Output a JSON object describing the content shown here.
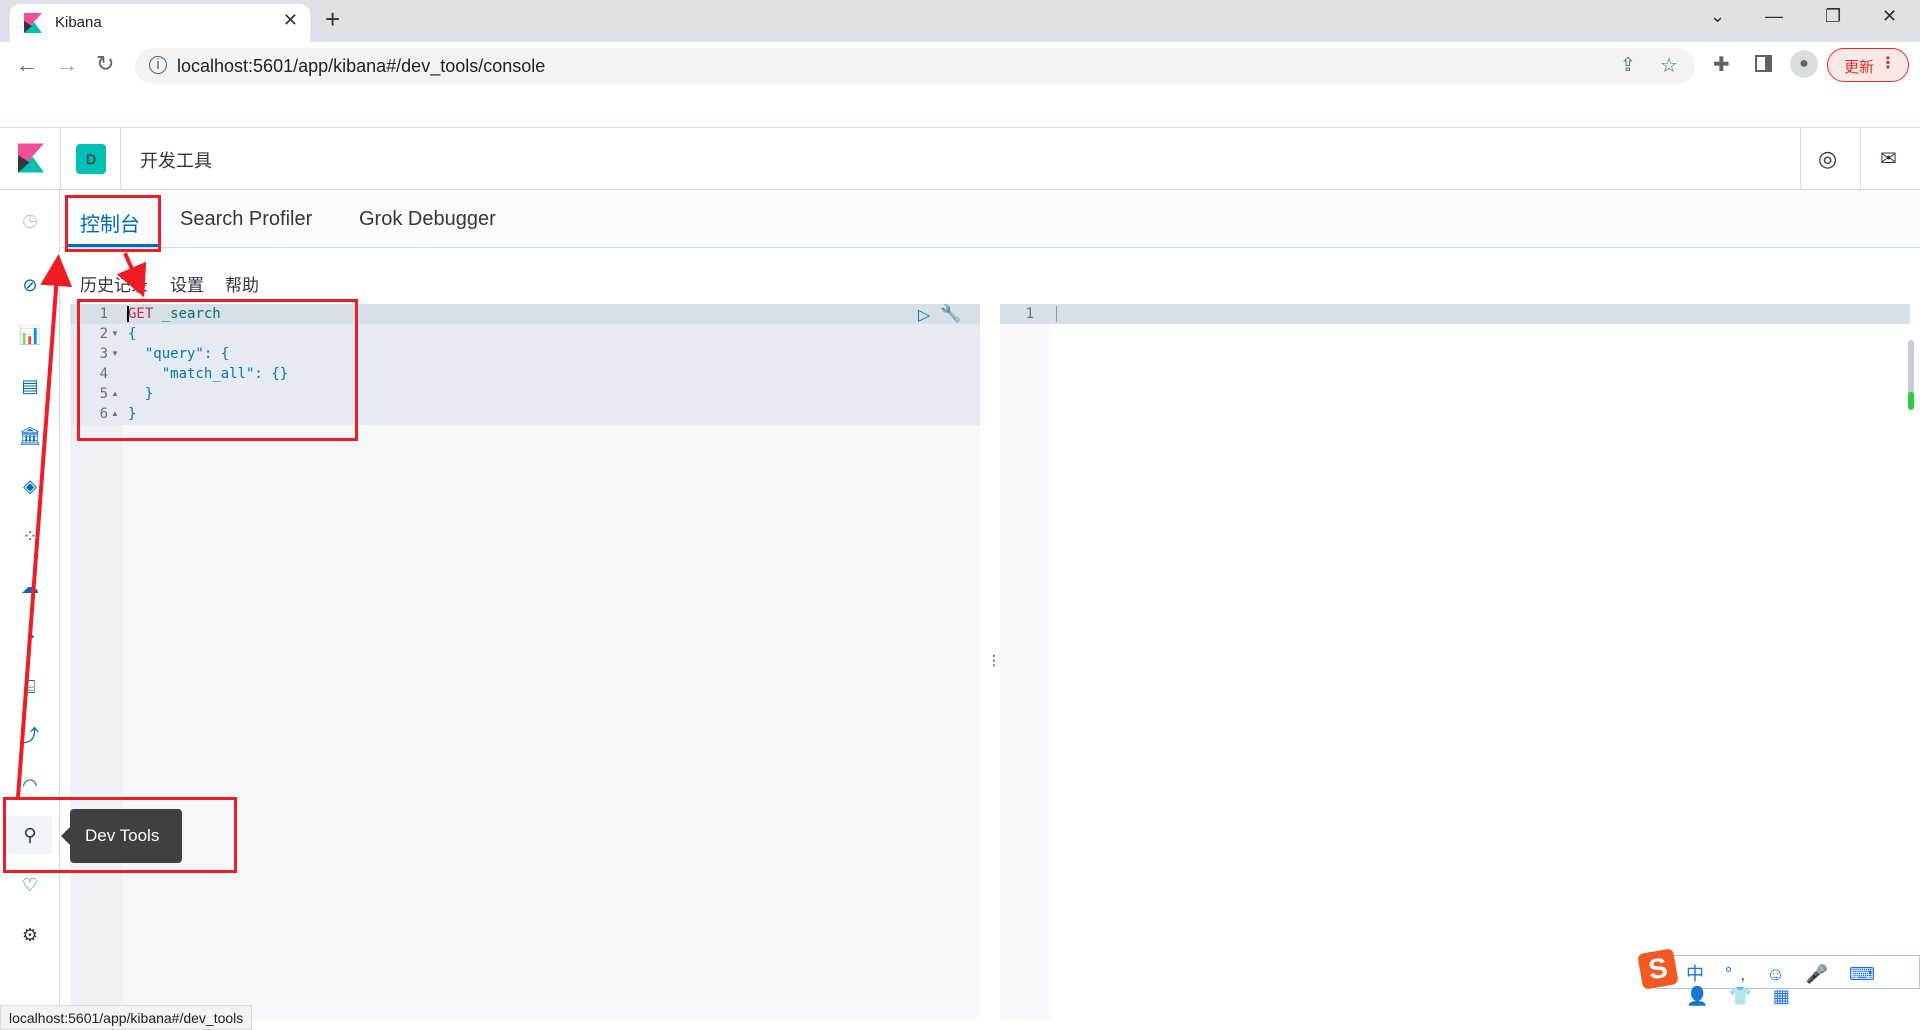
{
  "browser": {
    "tab_title": "Kibana",
    "url": "localhost:5601/app/kibana#/dev_tools/console",
    "update_label": "更新",
    "status_url": "localhost:5601/app/kibana#/dev_tools"
  },
  "header": {
    "avatar_letter": "D",
    "title": "开发工具"
  },
  "tabs": [
    {
      "label": "控制台",
      "active": true
    },
    {
      "label": "Search Profiler"
    },
    {
      "label": "Grok Debugger"
    }
  ],
  "subnav": [
    "历史记录",
    "设置",
    "帮助"
  ],
  "editor": {
    "lines": [
      {
        "n": "1",
        "fold": "",
        "method": "GET",
        "rest": " _search"
      },
      {
        "n": "2",
        "fold": "▼",
        "text": "{"
      },
      {
        "n": "3",
        "fold": "▼",
        "text": "  \"query\": {"
      },
      {
        "n": "4",
        "fold": "",
        "text": "    \"match_all\": {}"
      },
      {
        "n": "5",
        "fold": "▲",
        "text": "  }"
      },
      {
        "n": "6",
        "fold": "▲",
        "text": "}"
      }
    ]
  },
  "output": {
    "line_number": "1"
  },
  "tooltip": "Dev Tools",
  "ime": {
    "items": "中 °, ☺ 🎤 ⌨ 👤 👕 ▦"
  },
  "colors": {
    "accent": "#006bb8",
    "annotation": "#ee1c25",
    "avatar": "#00bfb3"
  }
}
